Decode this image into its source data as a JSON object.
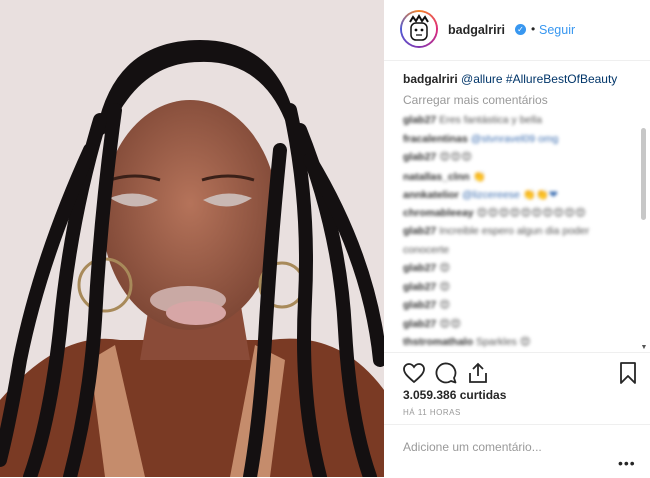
{
  "header": {
    "username": "badgalriri",
    "verified_icon": "verified-badge-icon",
    "separator": "•",
    "follow_label": "Seguir"
  },
  "caption": {
    "username": "badgalriri",
    "mention": "@allure",
    "hashtag": "#AllureBestOfBeauty"
  },
  "load_more": "Carregar mais comentários",
  "comments": [
    {
      "user": "glab27",
      "text": "Eres fantástica y bella"
    },
    {
      "user": "fracalentinas",
      "text": "@stvnravel09 omg",
      "mention": true
    },
    {
      "user": "glab27",
      "text": "😍😍😍"
    },
    {
      "user": "natallas_clnn",
      "text": "👏"
    },
    {
      "user": "annkatelior",
      "text": "@lizcereese 👏👏❤",
      "mention": true
    },
    {
      "user": "chromableeay",
      "text": "😍😍😍😍😍😍😍😍😍😍"
    },
    {
      "user": "glab27",
      "text": "Increible espero algun dia poder"
    },
    {
      "user": "",
      "text": "conocerte"
    },
    {
      "user": "glab27",
      "text": "😍"
    },
    {
      "user": "glab27",
      "text": "😍"
    },
    {
      "user": "glab27",
      "text": "😍"
    },
    {
      "user": "glab27",
      "text": "😍😍"
    },
    {
      "user": "thstromathalo",
      "text": "Sparkles 😍"
    }
  ],
  "likes_text": "3.059.386 curtidas",
  "time_text": "HÁ 11 HORAS",
  "add_comment_placeholder": "Adicione um comentário...",
  "more_label": "•••",
  "icons": {
    "like": "heart-icon",
    "comment": "comment-icon",
    "share": "share-icon",
    "save": "bookmark-icon"
  },
  "colors": {
    "link": "#3897f0",
    "hashtag": "#003569",
    "muted": "#999999",
    "text": "#262626"
  }
}
